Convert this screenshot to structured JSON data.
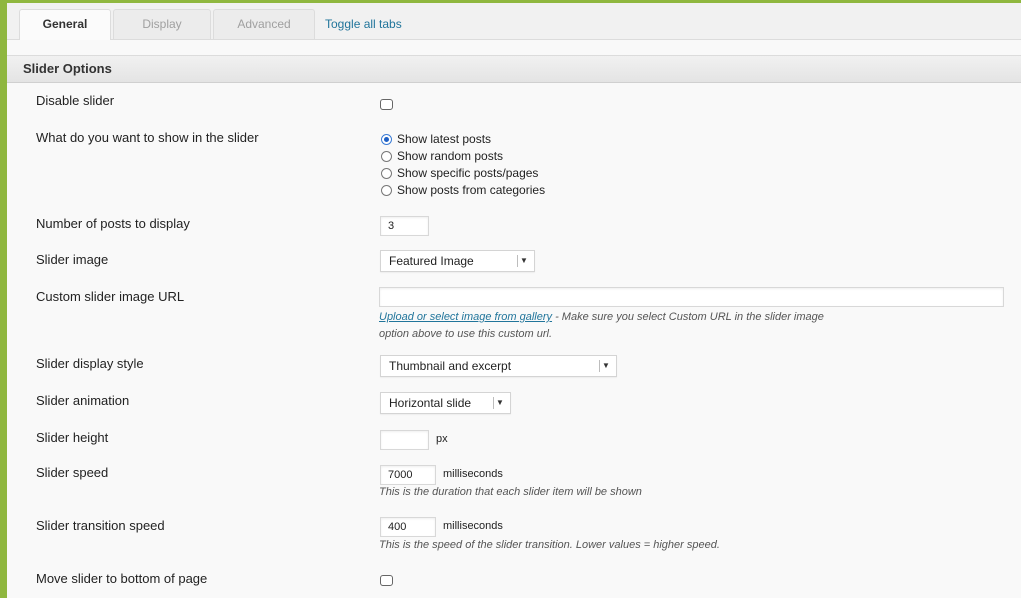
{
  "tabs": [
    {
      "label": "General",
      "active": true
    },
    {
      "label": "Display",
      "active": false
    },
    {
      "label": "Advanced",
      "active": false
    }
  ],
  "toggle_all_label": "Toggle all tabs",
  "section_title": "Slider Options",
  "fields": {
    "disable_slider": {
      "label": "Disable slider",
      "checked": false
    },
    "show_in_slider": {
      "label": "What do you want to show in the slider",
      "options": [
        "Show latest posts",
        "Show random posts",
        "Show specific posts/pages",
        "Show posts from categories"
      ],
      "selected": "Show latest posts"
    },
    "num_posts": {
      "label": "Number of posts to display",
      "value": "3"
    },
    "slider_image": {
      "label": "Slider image",
      "value": "Featured Image"
    },
    "custom_image_url": {
      "label": "Custom slider image URL",
      "value": "",
      "link_text": "Upload or select image from gallery",
      "hint_line1": " - Make sure you select Custom URL in the slider image",
      "hint_line2": "option above to use this custom url."
    },
    "display_style": {
      "label": "Slider display style",
      "value": "Thumbnail and excerpt"
    },
    "animation": {
      "label": "Slider animation",
      "value": "Horizontal slide"
    },
    "height": {
      "label": "Slider height",
      "value": "",
      "unit": "px"
    },
    "speed": {
      "label": "Slider speed",
      "value": "7000",
      "unit": "milliseconds",
      "hint": "This is the duration that each slider item will be shown"
    },
    "transition_speed": {
      "label": "Slider transition speed",
      "value": "400",
      "unit": "milliseconds",
      "hint": "This is the speed of the slider transition. Lower values = higher speed."
    },
    "move_bottom": {
      "label": "Move slider to bottom of page",
      "checked": false
    }
  },
  "colors": {
    "frame": "#8fb73f",
    "link": "#21759b",
    "radio_selected": "#1d5fc4"
  }
}
